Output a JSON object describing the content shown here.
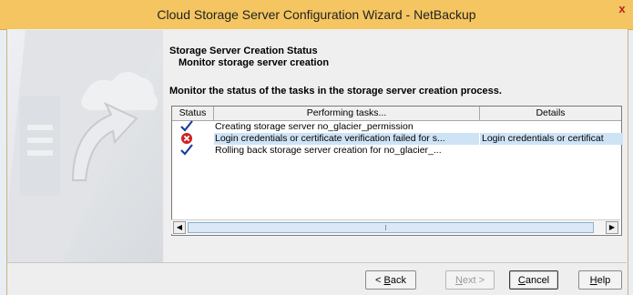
{
  "window": {
    "title": "Cloud Storage Server Configuration Wizard - NetBackup",
    "close_glyph": "x"
  },
  "header": {
    "title": "Storage Server Creation Status",
    "subtitle": "Monitor storage server creation",
    "description": "Monitor the status of the tasks in the storage server creation process."
  },
  "table": {
    "columns": [
      "Status",
      "Performing tasks...",
      "Details"
    ],
    "rows": [
      {
        "status_icon": "checkmark-icon",
        "task": "Creating storage server no_glacier_permission",
        "details": ""
      },
      {
        "status_icon": "error-icon",
        "task": "Login credentials or certificate verification failed for s...",
        "details": "Login credentials or certificat",
        "selected": true
      },
      {
        "status_icon": "checkmark-icon",
        "task": "Rolling back storage server creation for no_glacier_...",
        "details": ""
      }
    ]
  },
  "buttons": {
    "back_prefix": "< ",
    "back_mnemonic": "B",
    "back_rest": "ack",
    "next_mnemonic": "N",
    "next_rest": "ext >",
    "cancel_mnemonic": "C",
    "cancel_rest": "ancel",
    "help_mnemonic": "H",
    "help_rest": "elp"
  },
  "colors": {
    "titlebar": "#f4c560",
    "selected_row": "#cfe3f6",
    "check": "#1d3f9a",
    "error": "#d02020"
  }
}
